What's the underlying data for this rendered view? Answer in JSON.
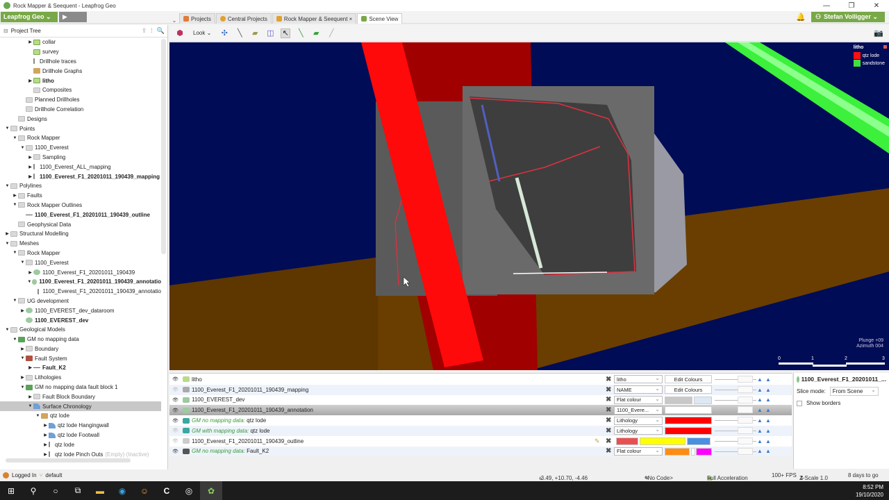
{
  "window": {
    "title": "Rock Mapper & Seequent - Leapfrog Geo",
    "controls": [
      "minimize",
      "maximize",
      "close"
    ]
  },
  "appbar": {
    "brand_button": "Leapfrog Geo ⌄",
    "play_label": "▶",
    "tabs": [
      {
        "label": "Projects",
        "icon": "projects-icon",
        "color": "#e07b39",
        "active": false
      },
      {
        "label": "Central Projects",
        "icon": "central-icon",
        "color": "#e0a030",
        "active": false
      },
      {
        "label": "Rock Mapper & Seequent ×",
        "icon": "project-icon",
        "color": "#e0a030",
        "active": false
      },
      {
        "label": "Scene View",
        "icon": "scene-icon",
        "color": "#79a848",
        "active": true
      }
    ],
    "user": "Stefan Volligger ⌄"
  },
  "project_tree": {
    "title": "Project Tree",
    "items": [
      {
        "label": "collar",
        "indent": 3,
        "arrow": "▶",
        "icon": "table",
        "bold": false
      },
      {
        "label": "survey",
        "indent": 3,
        "arrow": "",
        "icon": "table",
        "bold": false
      },
      {
        "label": "Drillhole traces",
        "indent": 3,
        "arrow": "",
        "icon": "trace",
        "bold": false
      },
      {
        "label": "Drillhole Graphs",
        "indent": 3,
        "arrow": "",
        "icon": "graph",
        "bold": false
      },
      {
        "label": "litho",
        "indent": 3,
        "arrow": "▶",
        "icon": "table",
        "bold": true
      },
      {
        "label": "Composites",
        "indent": 3,
        "arrow": "",
        "icon": "folder",
        "bold": false
      },
      {
        "label": "Planned Drillholes",
        "indent": 2,
        "arrow": "",
        "icon": "folder",
        "bold": false
      },
      {
        "label": "Drillhole Correlation",
        "indent": 2,
        "arrow": "",
        "icon": "folder",
        "bold": false
      },
      {
        "label": "Designs",
        "indent": 1,
        "arrow": "",
        "icon": "folder",
        "bold": false
      },
      {
        "label": "Points",
        "indent": 0,
        "arrow": "▼",
        "icon": "folder",
        "bold": false
      },
      {
        "label": "Rock Mapper",
        "indent": 1,
        "arrow": "▼",
        "icon": "folder",
        "bold": false
      },
      {
        "label": "1100_Everest",
        "indent": 2,
        "arrow": "▼",
        "icon": "folder",
        "bold": false
      },
      {
        "label": "Sampling",
        "indent": 3,
        "arrow": "▶",
        "icon": "folder",
        "bold": false
      },
      {
        "label": "1100_Everest_ALL_mapping",
        "indent": 3,
        "arrow": "▶",
        "icon": "trace",
        "bold": false
      },
      {
        "label": "1100_Everest_F1_20201011_190439_mapping",
        "indent": 3,
        "arrow": "▶",
        "icon": "trace",
        "bold": true
      },
      {
        "label": "Polylines",
        "indent": 0,
        "arrow": "▼",
        "icon": "folder",
        "bold": false
      },
      {
        "label": "Faults",
        "indent": 1,
        "arrow": "▶",
        "icon": "folder",
        "bold": false
      },
      {
        "label": "Rock Mapper Outlines",
        "indent": 1,
        "arrow": "▼",
        "icon": "folder",
        "bold": false
      },
      {
        "label": "1100_Everest_F1_20201011_190439_outline",
        "indent": 2,
        "arrow": "",
        "icon": "line",
        "bold": true
      },
      {
        "label": "Geophysical Data",
        "indent": 1,
        "arrow": "",
        "icon": "folder",
        "bold": false
      },
      {
        "label": "Structural Modelling",
        "indent": 0,
        "arrow": "▶",
        "icon": "folder",
        "bold": false
      },
      {
        "label": "Meshes",
        "indent": 0,
        "arrow": "▼",
        "icon": "folder",
        "bold": false
      },
      {
        "label": "Rock Mapper",
        "indent": 1,
        "arrow": "▼",
        "icon": "folder",
        "bold": false
      },
      {
        "label": "1100_Everest",
        "indent": 2,
        "arrow": "▼",
        "icon": "folder",
        "bold": false
      },
      {
        "label": "1100_Everest_F1_20201011_190439",
        "indent": 3,
        "arrow": "▶",
        "icon": "mesh",
        "bold": false
      },
      {
        "label": "1100_Everest_F1_20201011_190439_annotatio",
        "indent": 3,
        "arrow": "▼",
        "icon": "mesh",
        "bold": true
      },
      {
        "label": "1100_Everest_F1_20201011_190439_annotatio",
        "indent": 4,
        "arrow": "",
        "icon": "trace",
        "bold": false
      },
      {
        "label": "UG development",
        "indent": 1,
        "arrow": "▼",
        "icon": "folder",
        "bold": false
      },
      {
        "label": "1100_EVEREST_dev_dataroom",
        "indent": 2,
        "arrow": "▶",
        "icon": "mesh",
        "bold": false
      },
      {
        "label": "1100_EVEREST_dev",
        "indent": 2,
        "arrow": "",
        "icon": "mesh",
        "bold": true
      },
      {
        "label": "Geological Models",
        "indent": 0,
        "arrow": "▼",
        "icon": "folder",
        "bold": false
      },
      {
        "label": "GM no mapping data",
        "indent": 1,
        "arrow": "▼",
        "icon": "gm",
        "bold": false
      },
      {
        "label": "Boundary",
        "indent": 2,
        "arrow": "▶",
        "icon": "folder",
        "bold": false
      },
      {
        "label": "Fault System",
        "indent": 2,
        "arrow": "▼",
        "icon": "fault",
        "bold": false
      },
      {
        "label": "Fault_K2",
        "indent": 3,
        "arrow": "▶",
        "icon": "line",
        "bold": true
      },
      {
        "label": "Lithologies",
        "indent": 2,
        "arrow": "▶",
        "icon": "folder",
        "bold": false
      },
      {
        "label": "GM no mapping data fault block 1",
        "indent": 2,
        "arrow": "▼",
        "icon": "gm",
        "bold": false
      },
      {
        "label": "Fault Block Boundary",
        "indent": 3,
        "arrow": "▶",
        "icon": "folder",
        "bold": false
      },
      {
        "label": "Surface Chronology",
        "indent": 3,
        "arrow": "▼",
        "icon": "surface",
        "bold": false,
        "selected": true
      },
      {
        "label": "qtz lode",
        "indent": 4,
        "arrow": "▼",
        "icon": "graph",
        "bold": false
      },
      {
        "label": "qtz lode Hangingwall",
        "indent": 5,
        "arrow": "▶",
        "icon": "surface",
        "bold": false
      },
      {
        "label": "qtz lode Footwall",
        "indent": 5,
        "arrow": "▶",
        "icon": "surface",
        "bold": false
      },
      {
        "label": "qtz lode",
        "indent": 5,
        "arrow": "▶",
        "icon": "trace",
        "bold": false
      },
      {
        "label": "qtz lode Pinch Outs",
        "indent": 5,
        "arrow": "▶",
        "icon": "trace",
        "bold": false,
        "extra": "(Empty) (Inactive)"
      }
    ]
  },
  "status_left": {
    "logged_in": "Logged In",
    "branch": "default"
  },
  "toolbar3d": {
    "look_label": "Look ⌄",
    "tools": [
      "slice-icon",
      "drillhole-tool-icon",
      "pen-icon",
      "draw-surface-icon",
      "view-panels-icon",
      "select-icon",
      "draw-line-icon",
      "draw-green-icon",
      "ruler-icon"
    ]
  },
  "scene": {
    "legend": {
      "title": "litho",
      "items": [
        {
          "label": "qtz lode",
          "color": "#ff1010"
        },
        {
          "label": "sandstone",
          "color": "#40e040"
        }
      ]
    },
    "plunge": "Plunge +09",
    "azimuth": "Azimuth 004",
    "scale_ticks": [
      "0",
      "1",
      "2",
      "3"
    ],
    "colors": {
      "background": "#000c56",
      "lode_bright": "#ff0a0a",
      "lode_dark": "#a00000",
      "sandstone": "#3cf03c",
      "drive": "#6a3e00"
    }
  },
  "shape_list": {
    "rows": [
      {
        "name": "litho",
        "italic_prefix": "",
        "visible": true,
        "icon_color": "#b6dc88",
        "combo": "litho",
        "edit": "Edit Colours",
        "selected": false
      },
      {
        "name": "1100_Everest_F1_20201011_190439_mapping",
        "italic_prefix": "",
        "visible": false,
        "icon_color": "#aaa",
        "combo": "NAME",
        "edit": "Edit Colours",
        "selected": false
      },
      {
        "name": "1100_EVEREST_dev",
        "italic_prefix": "",
        "visible": true,
        "icon_color": "#9fc9a0",
        "combo": "Flat colour",
        "edit": "",
        "selected": false
      },
      {
        "name": "1100_Everest_F1_20201011_190439_annotation",
        "italic_prefix": "",
        "visible": true,
        "icon_color": "#9fc9a0",
        "combo": "1100_Evere...",
        "edit": "",
        "selected": true
      },
      {
        "name": "qtz lode",
        "italic_prefix": "GM no mapping data: ",
        "visible": true,
        "icon_color": "#3aa8a0",
        "combo": "Lithology",
        "edit": "",
        "selected": false
      },
      {
        "name": "qtz lode",
        "italic_prefix": "GM with mapping data: ",
        "visible": false,
        "icon_color": "#3aa8a0",
        "combo": "Lithology",
        "edit": "",
        "selected": false
      },
      {
        "name": "1100_Everest_F1_20201011_190439_outline",
        "italic_prefix": "",
        "visible": false,
        "icon_color": "#ccc",
        "combo": "",
        "edit": "",
        "selected": false
      },
      {
        "name": "Fault_K2",
        "italic_prefix": "GM no mapping data: ",
        "visible": true,
        "icon_color": "#555",
        "combo": "Flat colour",
        "edit": "",
        "selected": false
      }
    ],
    "colors": {
      "dev_flat": "#c8c8c8",
      "annotation": "#ffffff",
      "lithology": "#ff0000",
      "outline_a": "#e85050",
      "outline_b": "#ffff00",
      "outline_c": "#4a90e0",
      "fault_flat": "#ff8c10",
      "fault_b": "#ff00ff"
    }
  },
  "properties": {
    "title": "1100_Everest_F1_20201011_...",
    "slice_mode_label": "Slice mode:",
    "slice_mode_value": "From Scene",
    "show_borders_label": "Show borders",
    "show_borders_checked": false
  },
  "status3d": {
    "coords": "-3.49, +10.70, -4.46",
    "code": "<No Code>",
    "acceleration": "Full Acceleration",
    "fps": "100+ FPS",
    "zscale": "Z-Scale 1.0",
    "trial": "8 days to go"
  },
  "taskbar": {
    "icons": [
      "windows-start-icon",
      "search-icon",
      "cortana-icon",
      "task-view-icon",
      "file-explorer-icon",
      "edge-icon",
      "mail-icon",
      "c-app-icon",
      "obs-icon",
      "leapfrog-icon"
    ],
    "time": "8:52 PM",
    "date": "19/10/2020"
  }
}
